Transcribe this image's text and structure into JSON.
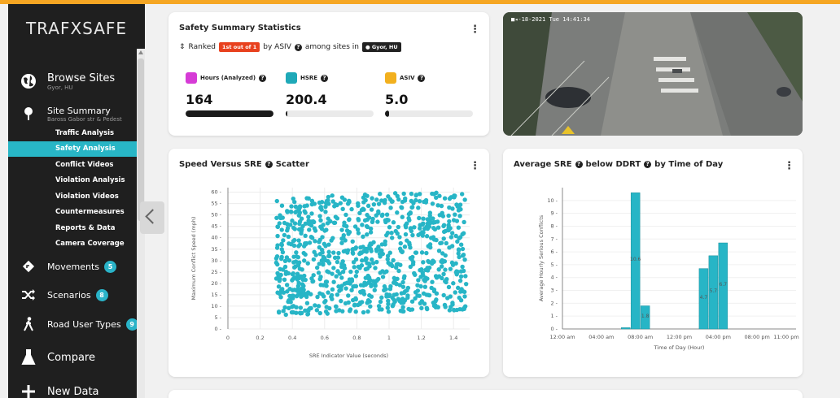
{
  "brand": "TRAFXSAFE",
  "sidebar": {
    "browse_sites": {
      "label": "Browse Sites",
      "sub": "Gyor, HU"
    },
    "site_summary": {
      "label": "Site Summary",
      "sub": "Baross Gabor str & Pedest"
    },
    "subitems": [
      "Traffic Analysis",
      "Safety Analysis",
      "Conflict Videos",
      "Violation Analysis",
      "Violation Videos",
      "Countermeasures",
      "Reports & Data",
      "Camera Coverage"
    ],
    "active_subitem": "Safety Analysis",
    "movements": {
      "label": "Movements",
      "badge": "5"
    },
    "scenarios": {
      "label": "Scenarios",
      "badge": "8"
    },
    "road_user_types": {
      "label": "Road User Types",
      "badge": "9"
    },
    "compare": {
      "label": "Compare"
    },
    "new_data": {
      "label": "New Data"
    }
  },
  "summary": {
    "title": "Safety Summary Statistics",
    "ranked_prefix": "Ranked",
    "rank_badge": "1st out of 1",
    "ranked_mid": "by ASIV",
    "ranked_suffix": "among sites in",
    "location_badge": "Gyor, HU",
    "stats": [
      {
        "label": "Hours (Analyzed)",
        "value": "164",
        "progress": 1.0,
        "color": "#d63bd6"
      },
      {
        "label": "HSRE",
        "value": "200.4",
        "progress": 0.02,
        "color": "#1fa9b8"
      },
      {
        "label": "ASIV",
        "value": "5.0",
        "progress": 0.05,
        "color": "#f2b01e"
      }
    ]
  },
  "camera": {
    "timestamp": "-18-2021 Tue 14:41:34"
  },
  "scatter": {
    "title": "Speed Versus SRE",
    "title_suffix": "Scatter",
    "chart_data": {
      "type": "scatter",
      "xlabel": "SRE Indicator Value (seconds)",
      "ylabel": "Maximum Conflict Speed (mph)",
      "xlim": [
        0,
        1.5
      ],
      "ylim": [
        0,
        62
      ],
      "x_ticks": [
        "0",
        "0.2",
        "0.4",
        "0.6",
        "0.8",
        "1",
        "1.2",
        "1.4"
      ],
      "y_ticks": [
        "0",
        "5",
        "10",
        "15",
        "20",
        "25",
        "30",
        "35",
        "40",
        "45",
        "50",
        "55",
        "60"
      ],
      "color": "#27b5c6",
      "note": "Dense cloud of points spanning x 0.3–1.5 s and y 5–62 mph"
    }
  },
  "sre_time": {
    "title": "Average SRE",
    "title_mid": "below DDRT",
    "title_suffix": "by Time of Day",
    "chart_data": {
      "type": "bar",
      "xlabel": "Time of Day (Hour)",
      "ylabel": "Average Hourly Serious Conflicts",
      "ylim": [
        0,
        11
      ],
      "y_ticks": [
        "0",
        "1",
        "2",
        "3",
        "4",
        "5",
        "6",
        "7",
        "8",
        "9",
        "10"
      ],
      "x_tick_labels": [
        "12:00 am",
        "04:00 am",
        "08:00 am",
        "12:00 pm",
        "04:00 pm",
        "08:00 pm",
        "11:00 pm"
      ],
      "x_tick_hours": [
        0,
        4,
        8,
        12,
        16,
        20,
        23
      ],
      "bars": [
        {
          "hour": 6,
          "value": 0.1,
          "label": ""
        },
        {
          "hour": 7,
          "value": 10.6,
          "label": "10.6"
        },
        {
          "hour": 8,
          "value": 1.8,
          "label": "1.8"
        },
        {
          "hour": 14,
          "value": 4.7,
          "label": "4.7"
        },
        {
          "hour": 15,
          "value": 5.7,
          "label": "5.7"
        },
        {
          "hour": 16,
          "value": 6.7,
          "label": "6.7"
        }
      ],
      "color": "#27b5c6"
    }
  }
}
